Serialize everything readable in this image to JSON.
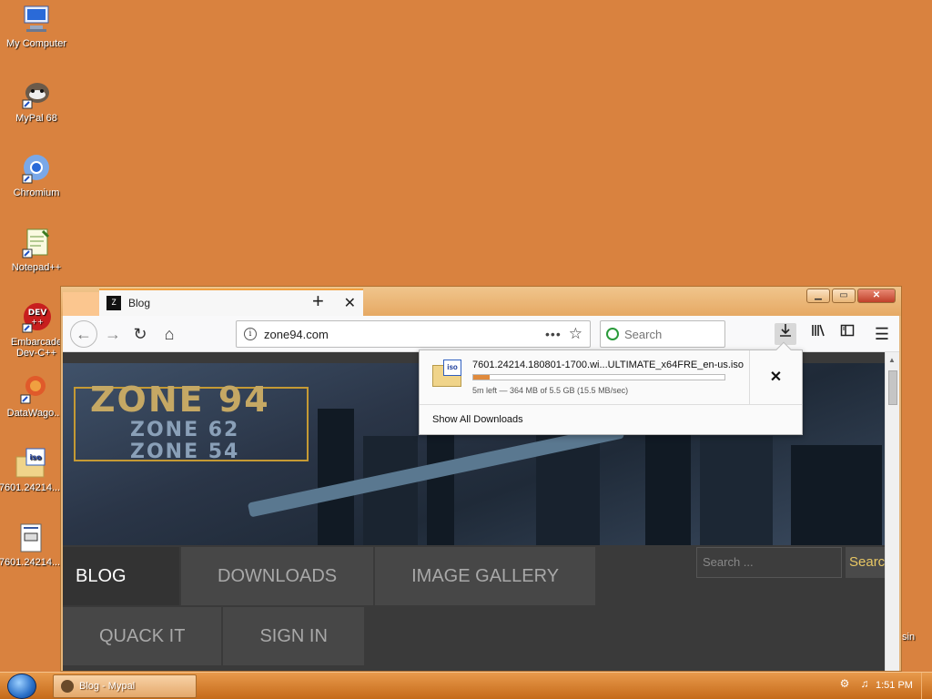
{
  "desktop": {
    "icons": [
      {
        "label": "My Computer",
        "icon": "computer-icon"
      },
      {
        "label": "MyPal 68",
        "icon": "mypal-icon"
      },
      {
        "label": "Chromium",
        "icon": "chromium-icon"
      },
      {
        "label": "Notepad++",
        "icon": "notepad-icon"
      },
      {
        "label": "Embarcadero Dev-C++",
        "line1": "Embarcade",
        "line2": "Dev-C++",
        "icon": "devcpp-icon"
      },
      {
        "label": "DataWago...",
        "icon": "datawago-icon"
      },
      {
        "label": "7601.24214....",
        "icon": "iso-file-icon"
      },
      {
        "label": "7601.24214....",
        "icon": "document-file-icon"
      }
    ],
    "partial_label": "sin"
  },
  "browser": {
    "tab": {
      "title": "Blog",
      "favicon_text": "Z"
    },
    "url": "zone94.com",
    "search_placeholder": "Search",
    "downloads": {
      "file_name": "7601.24214.180801-1700.wi...ULTIMATE_x64FRE_en-us.iso",
      "status": "5m left — 364 MB of 5.5 GB (15.5 MB/sec)",
      "progress": 0.066,
      "show_all_label": "Show All Downloads"
    }
  },
  "site": {
    "logo": {
      "main": "ZONE 94",
      "sub1": "ZONE 62",
      "sub2": "ZONE 54"
    },
    "menu_row1": [
      "BLOG",
      "DOWNLOADS",
      "IMAGE GALLERY"
    ],
    "menu_row2": [
      "QUACK IT",
      "SIGN IN"
    ],
    "search_placeholder": "Search ...",
    "search_button": "Search"
  },
  "taskbar": {
    "task_label": "Blog - Mypal",
    "clock": "1:51 PM"
  },
  "colors": {
    "desktop": "#d9823f",
    "accent": "#e08a3c",
    "site_search_button_text": "#e8c764"
  }
}
